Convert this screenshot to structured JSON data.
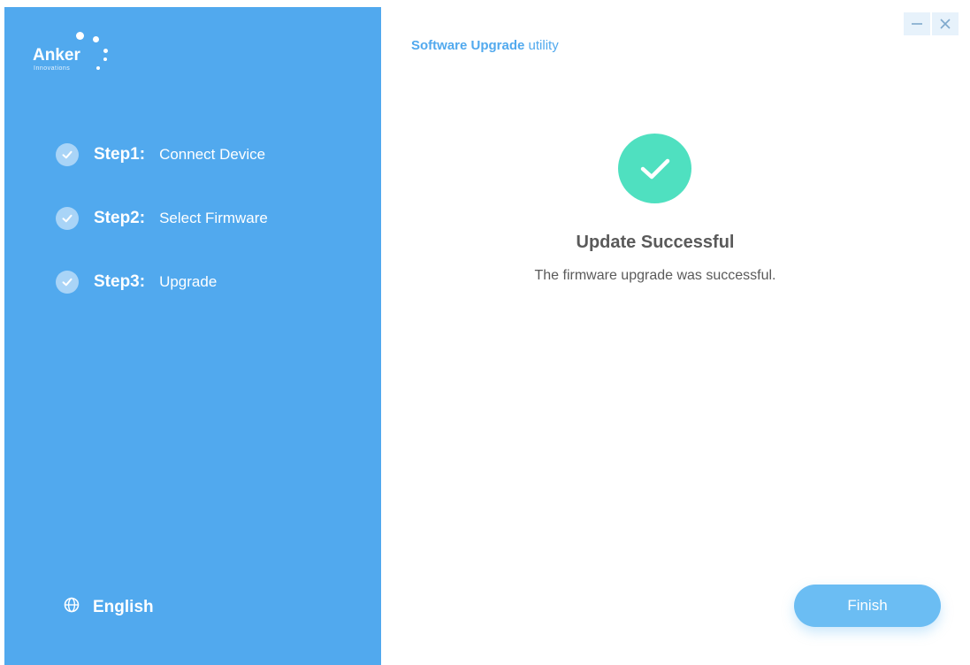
{
  "brand": {
    "name": "Anker",
    "sub": "Innovations"
  },
  "steps": [
    {
      "num": "Step1:",
      "label": "Connect Device",
      "status": "complete"
    },
    {
      "num": "Step2:",
      "label": "Select Firmware",
      "status": "complete"
    },
    {
      "num": "Step3:",
      "label": "Upgrade",
      "status": "complete"
    }
  ],
  "language": {
    "label": "English",
    "icon": "globe-icon"
  },
  "header": {
    "title_strong": "Software Upgrade",
    "title_rest": "utility"
  },
  "window_controls": {
    "minimize_icon": "minimize-icon",
    "close_icon": "close-icon"
  },
  "status": {
    "icon": "check-icon",
    "title": "Update Successful",
    "message": "The firmware upgrade was successful."
  },
  "actions": {
    "finish_label": "Finish"
  },
  "colors": {
    "sidebar": "#51a9ee",
    "success": "#4fe0c0",
    "button": "#6bbdf3",
    "accent_text": "#51a9ee"
  }
}
